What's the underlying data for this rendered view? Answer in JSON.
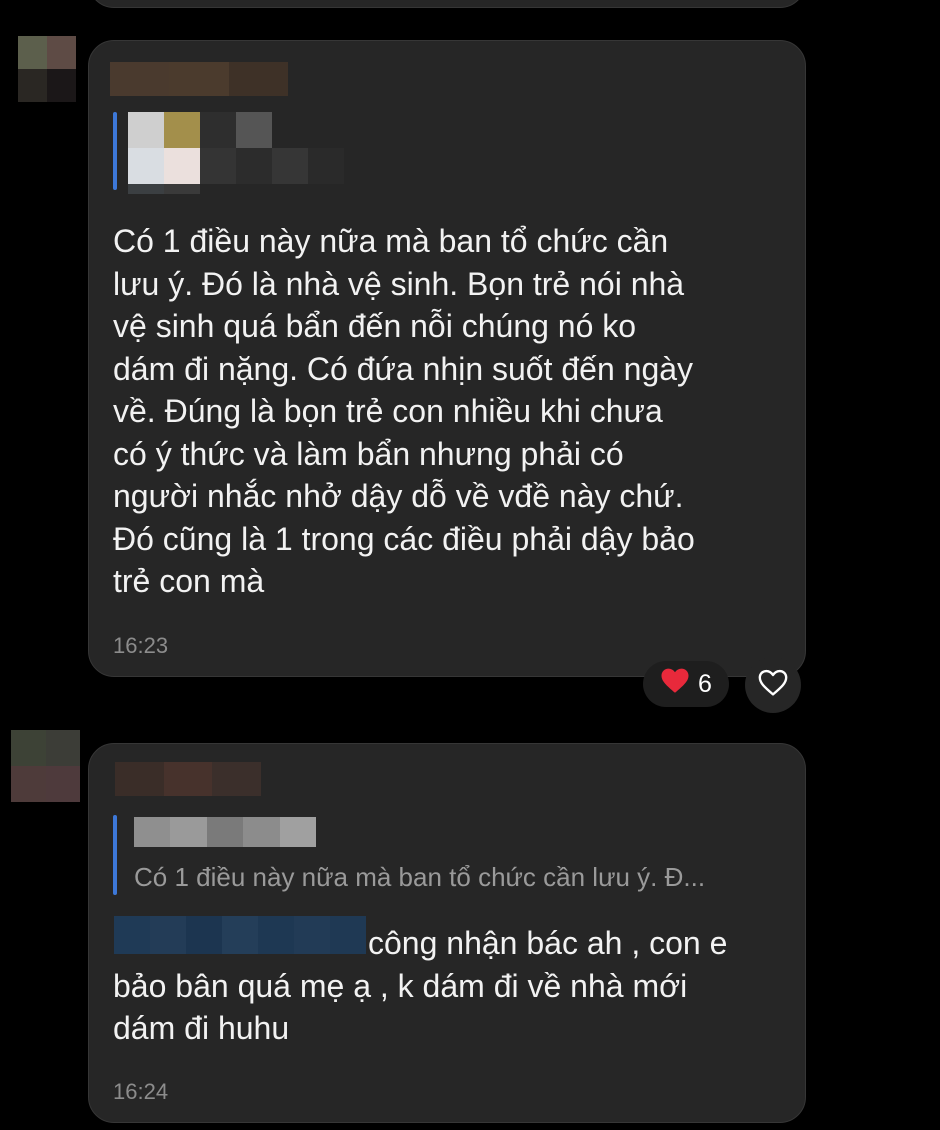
{
  "messages": [
    {
      "text": "Có 1 điều này nữa mà ban tổ chức cần\nlưu ý. Đó là nhà vệ sinh. Bọn trẻ nói nhà\nvệ sinh quá bẩn đến nỗi chúng nó ko\ndám đi nặng. Có đứa nhịn suốt đến ngày\nvề. Đúng là bọn trẻ con nhiều khi chưa\ncó ý thức và làm bẩn nhưng phải có\nngười nhắc nhở dậy dỗ về vđề này chứ.\nĐó cũng là 1 trong các điều phải dậy bảo\ntrẻ con mà",
      "time": "16:23",
      "reaction": {
        "emoji": "❤️",
        "count": "6"
      }
    },
    {
      "quote_text": "Có 1 điều này nữa mà ban tổ chức cần lưu ý. Đ...",
      "text": "công nhận bác ah , con e\nbảo bân quá mẹ ạ , k dám đi về nhà mới\ndám đi huhu",
      "time": "16:24"
    }
  ],
  "colors": {
    "background": "#000000",
    "bubble": "#262626",
    "quote_bar": "#3d78d8",
    "reaction_heart": "#e8293b"
  },
  "icons": [
    "heart-outline-icon",
    "red-heart-emoji"
  ]
}
